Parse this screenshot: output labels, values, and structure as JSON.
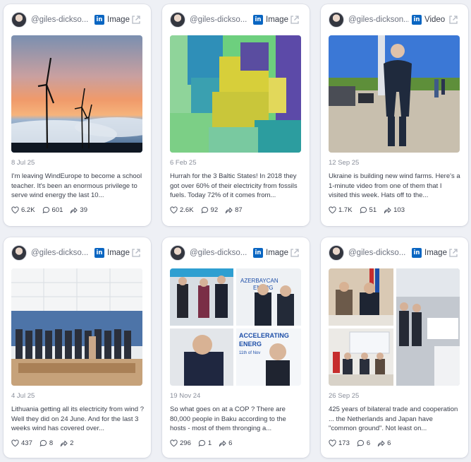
{
  "posts": [
    {
      "handle": "@giles-dickso...",
      "badge": "in",
      "type": "Image",
      "date": "8 Jul 25",
      "text": "I'm leaving WindEurope to become a school teacher. It's been an enormous privilege to serve wind energy the last 10...",
      "likes": "6.2K",
      "comments": "601",
      "shares": "39",
      "media_icon": "wind-turbines-sunset-photo"
    },
    {
      "handle": "@giles-dickso...",
      "badge": "in",
      "type": "Image",
      "date": "6 Feb 25",
      "text": "Hurrah for the 3 Baltic States! In 2018 they got over 60% of their electricity from fossils fuels.  Today 72% of it comes from...",
      "likes": "2.6K",
      "comments": "92",
      "shares": "87",
      "media_icon": "pixel-map-photo"
    },
    {
      "handle": "@giles-dickson...",
      "badge": "in",
      "type": "Video",
      "date": "12 Sep 25",
      "text": "Ukraine is building new wind farms. Here's a 1-minute video from one of them that I visited this week. Hats off to the...",
      "likes": "1.7K",
      "comments": "51",
      "shares": "103",
      "media_icon": "man-in-suit-photo"
    },
    {
      "handle": "@giles-dickso...",
      "badge": "in",
      "type": "Image",
      "date": "4 Jul 25",
      "text": "Lithuania getting all its electricity from wind ? Well they did on 24 June. And for the last 3 weeks wind has covered over...",
      "likes": "437",
      "comments": "8",
      "shares": "2",
      "media_icon": "group-photo"
    },
    {
      "handle": "@giles-dickso...",
      "badge": "in",
      "type": "Image",
      "date": "19 Nov 24",
      "text": "So what goes on at a COP ? There are 80,000 people in Baku according to the hosts - most of them thronging a...",
      "likes": "296",
      "comments": "1",
      "shares": "6",
      "media_icon": "collage-photo",
      "collage_text": [
        "AZERBAYCAN",
        "ENERG",
        "ACCELERATING",
        "ENERG",
        "11th of Nov"
      ]
    },
    {
      "handle": "@giles-dickso...",
      "badge": "in",
      "type": "Image",
      "date": "26 Sep 25",
      "text": "425 years of bilateral trade and cooperation ... the Netherlands and Japan have \"common ground\". Not least on...",
      "likes": "173",
      "comments": "6",
      "shares": "6",
      "media_icon": "conference-collage-photo"
    }
  ],
  "colors": {
    "linkedin": "#0a66c2",
    "card_bg": "#ffffff",
    "page_bg": "#eef0f5"
  }
}
